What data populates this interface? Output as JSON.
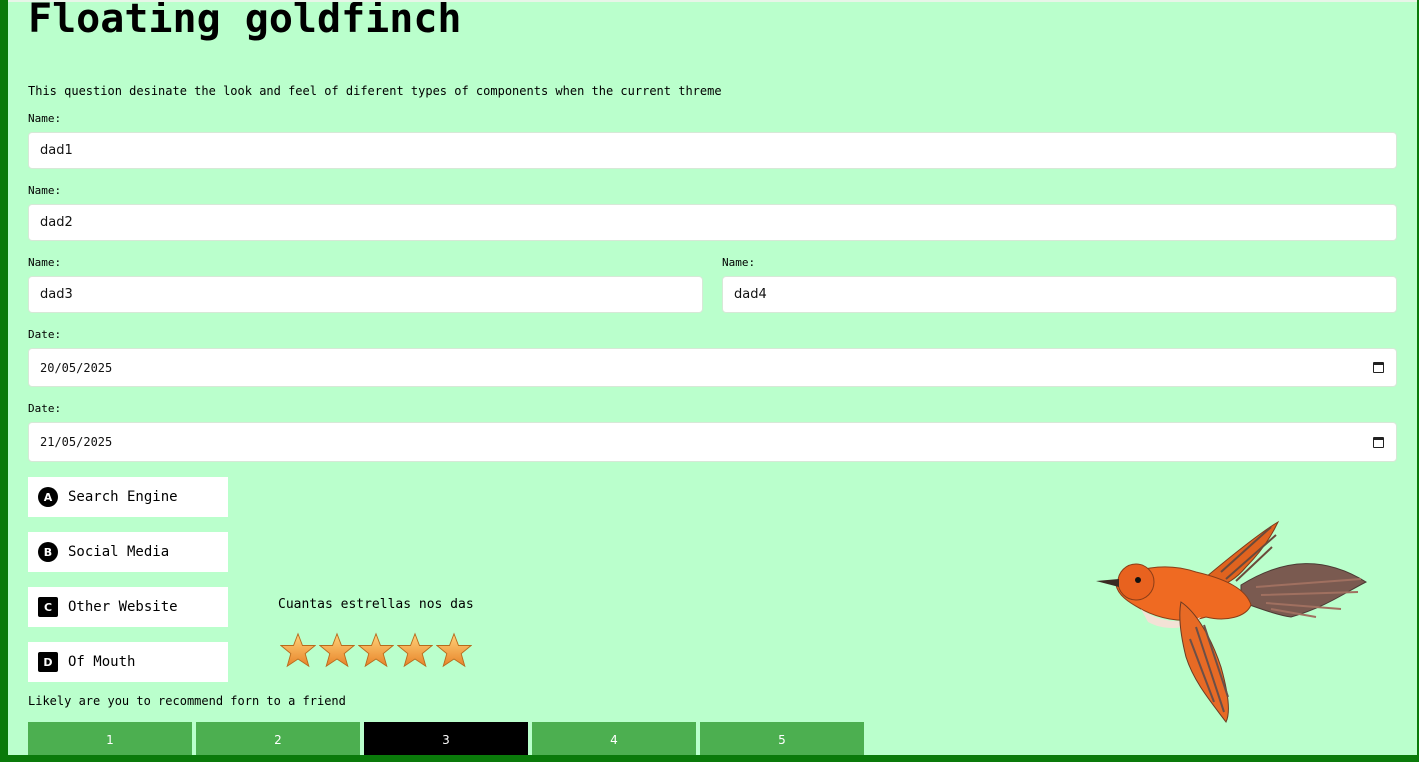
{
  "title": "Floating goldfinch",
  "description": "This question desinate the look and feel of diferent types of components when the current threme",
  "fields": [
    {
      "label": "Name:",
      "value": "dad1"
    },
    {
      "label": "Name:",
      "value": "dad2"
    },
    {
      "label": "Name:",
      "value": "dad3"
    },
    {
      "label": "Name:",
      "value": "dad4"
    }
  ],
  "dates": [
    {
      "label": "Date:",
      "value": "20/05/2025"
    },
    {
      "label": "Date:",
      "value": "21/05/2025"
    }
  ],
  "options": [
    {
      "key": "A",
      "label": "Search Engine"
    },
    {
      "key": "B",
      "label": "Social Media"
    },
    {
      "key": "C",
      "label": "Other Website"
    },
    {
      "key": "D",
      "label": "Of Mouth"
    }
  ],
  "rating": {
    "label": "Cuantas estrellas nos das",
    "max": 5,
    "value": 5
  },
  "recommend": {
    "label": "Likely are you to recommend forn to a friend",
    "options": [
      "1",
      "2",
      "3",
      "4",
      "5"
    ],
    "selected": "3"
  },
  "colors": {
    "background": "#baffcc",
    "frame": "#0a7a0a",
    "scale_button": "#4caf50",
    "scale_selected": "#000000",
    "star": "#f0a030"
  },
  "icons": {
    "date": "calendar-icon",
    "rating": "star-icon",
    "decoration": "bird-illustration"
  }
}
